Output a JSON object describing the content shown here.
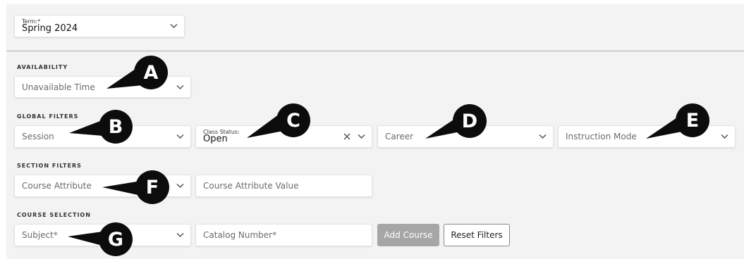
{
  "term": {
    "label": "Term:*",
    "value": "Spring 2024"
  },
  "availability": {
    "section_label": "AVAILABILITY",
    "unavailable_time": "Unavailable Time"
  },
  "global_filters": {
    "section_label": "GLOBAL FILTERS",
    "session": "Session",
    "class_status_label": "Class Status:",
    "class_status_value": "Open",
    "career": "Career",
    "instruction_mode": "Instruction Mode"
  },
  "section_filters": {
    "section_label": "SECTION FILTERS",
    "course_attribute": "Course Attribute",
    "course_attribute_value": "Course Attribute Value"
  },
  "course_selection": {
    "section_label": "COURSE SELECTION",
    "subject": "Subject*",
    "catalog_number": "Catalog Number*",
    "add_course": "Add Course",
    "reset_filters": "Reset Filters"
  },
  "callouts": {
    "a": "A",
    "b": "B",
    "c": "C",
    "d": "D",
    "e": "E",
    "f": "F",
    "g": "G"
  },
  "icons": {
    "chevron": "chevron-down-icon",
    "clear": "close-icon"
  },
  "colors": {
    "panel_bg": "#f3f3f3",
    "callout_bg": "#0c0c0c",
    "add_button_bg": "#a6a6a6"
  }
}
